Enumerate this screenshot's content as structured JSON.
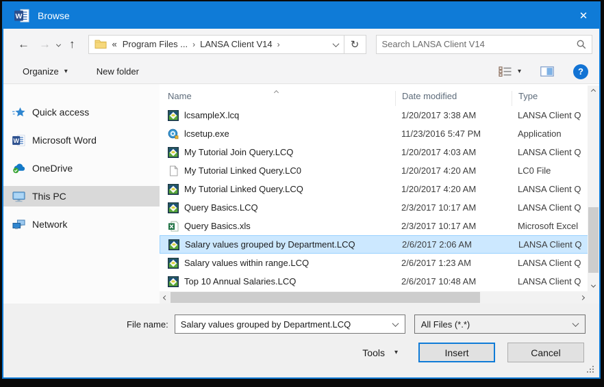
{
  "window": {
    "title": "Browse"
  },
  "icons": {
    "back": "←",
    "forward": "→",
    "up": "↑",
    "refresh": "↻",
    "close": "✕",
    "help": "?",
    "dropdown_arrow": "▾"
  },
  "navbar": {
    "breadcrumb": {
      "collapsed": "«",
      "first": "Program Files ...",
      "second": "LANSA Client V14",
      "separator": "›"
    },
    "search_placeholder": "Search LANSA Client V14"
  },
  "toolbar": {
    "organize": "Organize",
    "new_folder": "New folder"
  },
  "sidebar": {
    "items": [
      {
        "label": "Quick access",
        "icon": "quick-access-star-icon",
        "selected": false
      },
      {
        "label": "Microsoft Word",
        "icon": "word-app-icon",
        "selected": false
      },
      {
        "label": "OneDrive",
        "icon": "onedrive-cloud-icon",
        "selected": false
      },
      {
        "label": "This PC",
        "icon": "this-pc-monitor-icon",
        "selected": true
      },
      {
        "label": "Network",
        "icon": "network-icon",
        "selected": false
      }
    ]
  },
  "list": {
    "columns": [
      "Name",
      "Date modified",
      "Type"
    ],
    "rows": [
      {
        "name": "lcsampleX.lcq",
        "date": "1/20/2017 3:38 AM",
        "type": "LANSA Client Q",
        "icon": "lcq-file-icon",
        "selected": false
      },
      {
        "name": "lcsetup.exe",
        "date": "11/23/2016 5:47 PM",
        "type": "Application",
        "icon": "application-icon",
        "selected": false
      },
      {
        "name": "My Tutorial Join Query.LCQ",
        "date": "1/20/2017 4:03 AM",
        "type": "LANSA Client Q",
        "icon": "lcq-file-icon",
        "selected": false
      },
      {
        "name": "My Tutorial Linked Query.LC0",
        "date": "1/20/2017 4:20 AM",
        "type": "LC0 File",
        "icon": "generic-file-icon",
        "selected": false
      },
      {
        "name": "My Tutorial Linked Query.LCQ",
        "date": "1/20/2017 4:20 AM",
        "type": "LANSA Client Q",
        "icon": "lcq-file-icon",
        "selected": false
      },
      {
        "name": "Query Basics.LCQ",
        "date": "2/3/2017 10:17 AM",
        "type": "LANSA Client Q",
        "icon": "lcq-file-icon",
        "selected": false
      },
      {
        "name": "Query Basics.xls",
        "date": "2/3/2017 10:17 AM",
        "type": "Microsoft Excel",
        "icon": "excel-file-icon",
        "selected": false
      },
      {
        "name": "Salary values grouped by Department.LCQ",
        "date": "2/6/2017 2:06 AM",
        "type": "LANSA Client Q",
        "icon": "lcq-file-icon",
        "selected": true
      },
      {
        "name": "Salary values within range.LCQ",
        "date": "2/6/2017 1:23 AM",
        "type": "LANSA Client Q",
        "icon": "lcq-file-icon",
        "selected": false
      },
      {
        "name": "Top 10 Annual Salaries.LCQ",
        "date": "2/6/2017 10:48 AM",
        "type": "LANSA Client Q",
        "icon": "lcq-file-icon",
        "selected": false
      }
    ]
  },
  "footer": {
    "file_name_label": "File name:",
    "file_name_value": "Salary values grouped by Department.LCQ",
    "file_type_value": "All Files (*.*)",
    "tools": "Tools",
    "insert": "Insert",
    "cancel": "Cancel"
  },
  "colors": {
    "accent": "#0f7bd7",
    "selection_bg": "#cce8ff",
    "selection_border": "#99d1ff",
    "sidebar_selected": "#d9d9d9"
  }
}
